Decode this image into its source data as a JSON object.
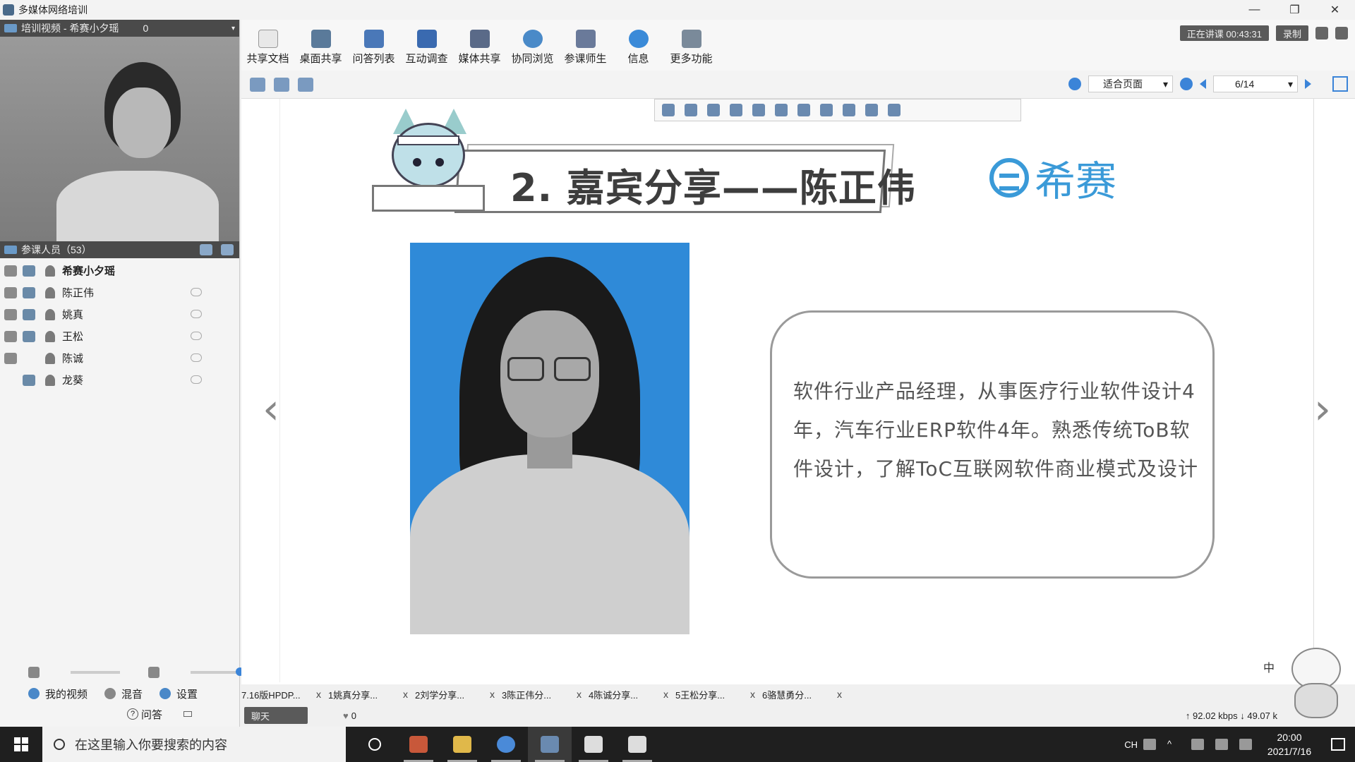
{
  "window": {
    "title": "多媒体网络培训",
    "controls": [
      "—",
      "❐",
      "✕"
    ]
  },
  "left_panel": {
    "video_header": {
      "title": "培训视频 - 希赛小夕瑶",
      "count": "0"
    },
    "attendees_header": {
      "title": "参课人员（53）"
    },
    "participants": [
      {
        "name": "希赛小夕瑶"
      },
      {
        "name": "陈正伟"
      },
      {
        "name": "姚真"
      },
      {
        "name": "王松"
      },
      {
        "name": "陈诚"
      },
      {
        "name": "龙葵"
      }
    ],
    "bottom": {
      "my_video": "我的视频",
      "mix": "混音",
      "settings": "设置",
      "qa": "问答",
      "qa_icon": "?"
    }
  },
  "toolbar": {
    "items": [
      {
        "label": "共享文档",
        "icon": "document-icon"
      },
      {
        "label": "桌面共享",
        "icon": "desktop-share-icon"
      },
      {
        "label": "问答列表",
        "icon": "qa-list-icon"
      },
      {
        "label": "互动调查",
        "icon": "survey-icon"
      },
      {
        "label": "媒体共享",
        "icon": "media-share-icon"
      },
      {
        "label": "协同浏览",
        "icon": "co-browse-icon"
      },
      {
        "label": "参课师生",
        "icon": "people-icon"
      },
      {
        "label": "信息",
        "icon": "info-icon"
      },
      {
        "label": "更多功能",
        "icon": "more-icon"
      }
    ],
    "live_status": "正在讲课 00:43:31",
    "record": "录制"
  },
  "toolbar2": {
    "fit": "适合页面",
    "page": "6/14"
  },
  "slide": {
    "title": "2. 嘉宾分享——陈正伟",
    "brand": "希赛",
    "bio": "软件行业产品经理，从事医疗行业软件设计4年，汽车行业ERP软件4年。熟悉传统ToB软件设计，了解ToC互联网软件商业模式及设计",
    "prev": "‹",
    "next": "›"
  },
  "doc_tabs": [
    {
      "label": "7.16版HPDP..."
    },
    {
      "label": "1姚真分享..."
    },
    {
      "label": "2刘学分享..."
    },
    {
      "label": "3陈正伟分..."
    },
    {
      "label": "4陈诚分享..."
    },
    {
      "label": "5王松分享..."
    },
    {
      "label": "6骆慧勇分..."
    }
  ],
  "status": {
    "chat": "聊天",
    "likes": "0",
    "rates": "↑ 92.02 kbps   ↓ 49.07 k",
    "mascot_text": "中"
  },
  "taskbar": {
    "search_placeholder": "在这里输入你要搜索的内容",
    "ime": "CH",
    "time": "20:00",
    "date": "2021/7/16"
  },
  "colors": {
    "accent": "#3b84d8",
    "brand": "#3a9ad8",
    "photo_bg": "#2f8ad8"
  }
}
